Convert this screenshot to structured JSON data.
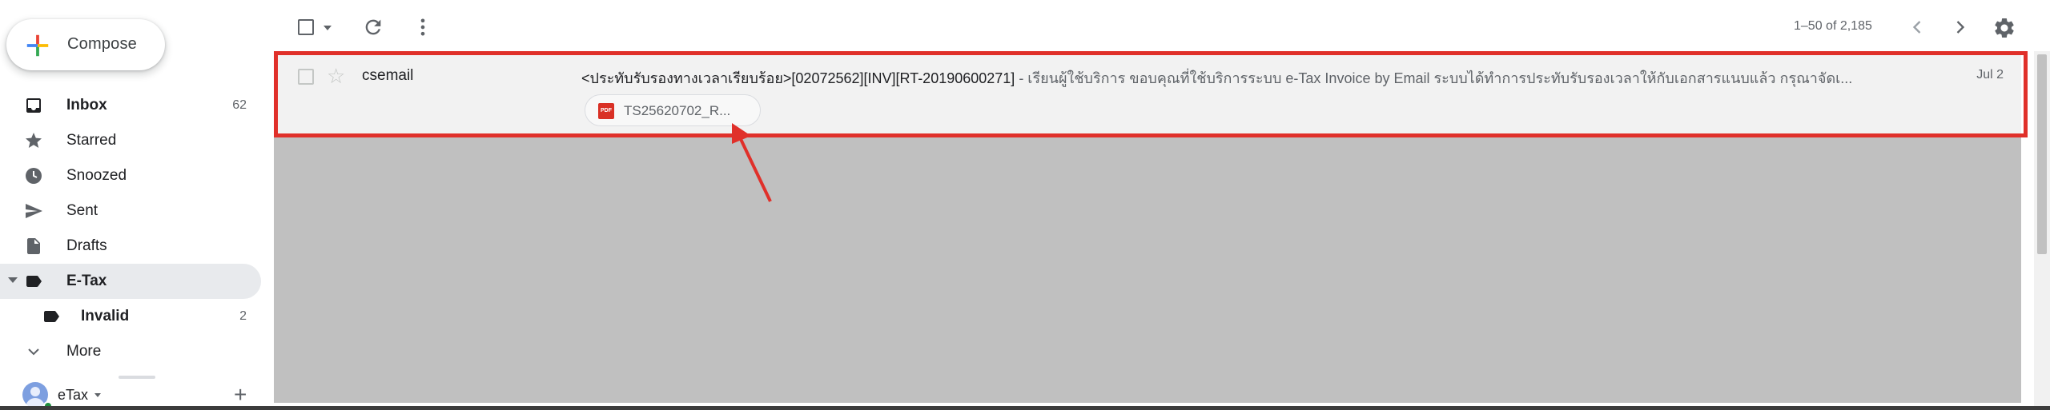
{
  "compose": {
    "label": "Compose"
  },
  "sidebar": {
    "items": [
      {
        "label": "Inbox",
        "count": "62",
        "icon": "inbox-icon"
      },
      {
        "label": "Starred",
        "count": "",
        "icon": "star-icon"
      },
      {
        "label": "Snoozed",
        "count": "",
        "icon": "clock-icon"
      },
      {
        "label": "Sent",
        "count": "",
        "icon": "send-icon"
      },
      {
        "label": "Drafts",
        "count": "",
        "icon": "draft-icon"
      },
      {
        "label": "E-Tax",
        "count": "",
        "icon": "label-icon"
      },
      {
        "label": "Invalid",
        "count": "2",
        "icon": "label-icon"
      },
      {
        "label": "More",
        "count": "",
        "icon": "chevron-down-icon"
      }
    ]
  },
  "account": {
    "name": "eTax",
    "add_symbol": "+"
  },
  "toolbar": {
    "page_info": "1–50 of 2,185"
  },
  "email": {
    "sender": "csemail",
    "subject": "<ประทับรับรองทางเวลาเรียบร้อย>[02072562][INV][RT-20190600271]",
    "snippet": " - เรียนผู้ใช้บริการ ขอบคุณที่ใช้บริการระบบ e-Tax Invoice by Email ระบบได้ทำการประทับรับรองเวลาให้กับเอกสารแนบแล้ว กรุณาจัดเ...",
    "date": "Jul 2",
    "attachment": {
      "name": "TS25620702_R...",
      "badge": "PDF"
    }
  },
  "colors": {
    "highlight": "#e0302a",
    "active_nav": "#e8eaed",
    "pdf_red": "#d93025"
  }
}
